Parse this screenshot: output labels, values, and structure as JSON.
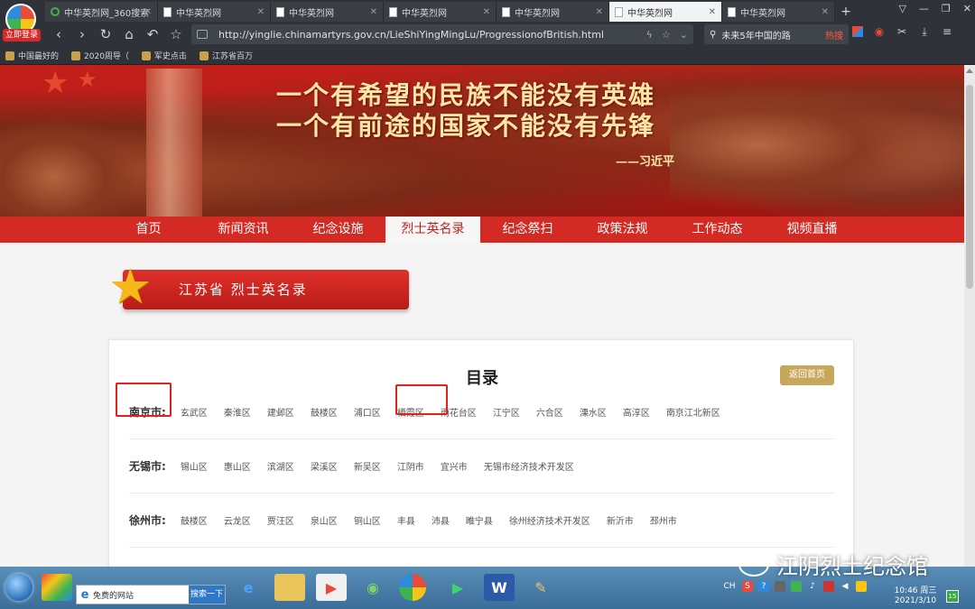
{
  "browser": {
    "login_badge": "立即登录",
    "tabs": [
      {
        "label": "中华英烈网_360搜索",
        "active": false,
        "icon": "search"
      },
      {
        "label": "中华英烈网",
        "active": false,
        "icon": "page"
      },
      {
        "label": "中华英烈网",
        "active": false,
        "icon": "page"
      },
      {
        "label": "中华英烈网",
        "active": false,
        "icon": "page"
      },
      {
        "label": "中华英烈网",
        "active": false,
        "icon": "page"
      },
      {
        "label": "中华英烈网",
        "active": true,
        "icon": "page"
      },
      {
        "label": "中华英烈网",
        "active": false,
        "icon": "page"
      }
    ],
    "url": "http://yinglie.chinamartyrs.gov.cn/LieShiYingMingLu/ProgressionofBritish.html",
    "search_value": "未来5年中国的路",
    "search_hot": "热搜",
    "bookmarks": [
      "中国最好的",
      "2020周导（",
      "军史点击",
      "江苏省百万"
    ]
  },
  "page": {
    "slogan_line1": "一个有希望的民族不能没有英雄",
    "slogan_line2": "一个有前途的国家不能没有先锋",
    "slogan_author": "——习近平",
    "nav": [
      "首页",
      "新闻资讯",
      "纪念设施",
      "烈士英名录",
      "纪念祭扫",
      "政策法规",
      "工作动态",
      "视频直播"
    ],
    "nav_active": "烈士英名录",
    "section_title": "江苏省 烈士英名录",
    "directory_title": "目录",
    "back_button": "返回首页",
    "rows": [
      {
        "city": "南京市:",
        "districts": [
          "玄武区",
          "秦淮区",
          "建邺区",
          "鼓楼区",
          "浦口区",
          "栖霞区",
          "雨花台区",
          "江宁区",
          "六合区",
          "溧水区",
          "高淳区",
          "南京江北新区"
        ]
      },
      {
        "city": "无锡市:",
        "districts": [
          "锡山区",
          "惠山区",
          "滨湖区",
          "梁溪区",
          "新吴区",
          "江阴市",
          "宜兴市",
          "无锡市经济技术开发区"
        ]
      },
      {
        "city": "徐州市:",
        "districts": [
          "鼓楼区",
          "云龙区",
          "贾汪区",
          "泉山区",
          "铜山区",
          "丰县",
          "沛县",
          "睢宁县",
          "徐州经济技术开发区",
          "新沂市",
          "邳州市"
        ]
      }
    ]
  },
  "taskbar": {
    "search_placeholder": "免费的网站",
    "search_button": "搜索一下",
    "tray_lang": "CH",
    "time": "10:46 周三",
    "date": "2021/3/10",
    "notif_count": "15"
  },
  "watermark": "江阴烈士纪念馆",
  "colors": {
    "nav_red": "#d42a24",
    "highlight": "#e0221a",
    "gold": "#c9a75a"
  }
}
